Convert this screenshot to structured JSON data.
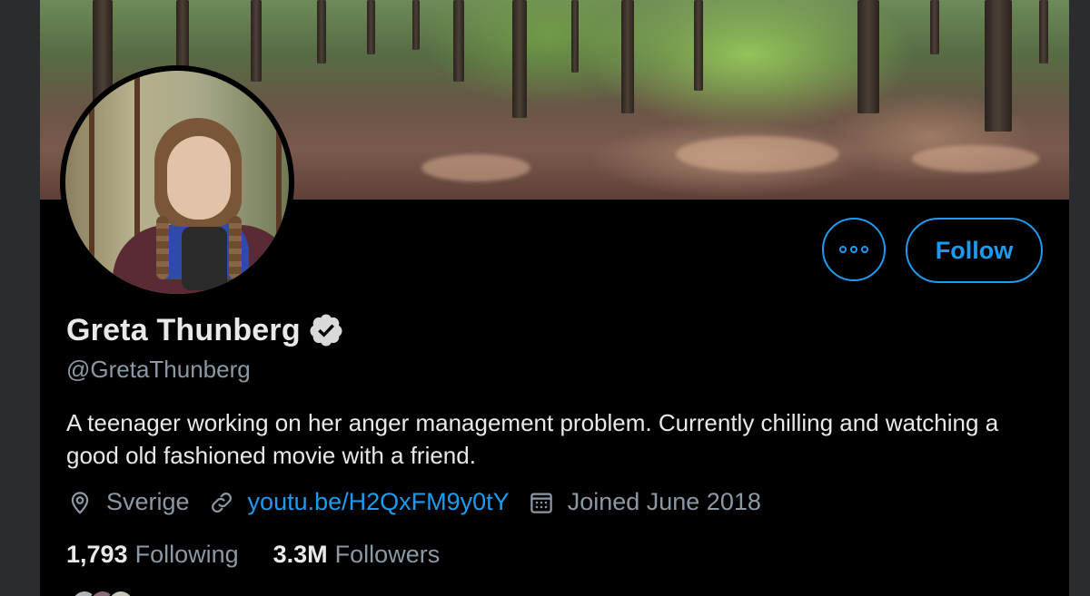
{
  "profile": {
    "display_name": "Greta Thunberg",
    "verified": true,
    "handle": "@GretaThunberg",
    "bio": "A teenager working on her anger management problem. Currently chilling and watching a good old fashioned movie with a friend.",
    "location": "Sverige",
    "website": "youtu.be/H2QxFM9y0tY",
    "joined": "Joined June 2018",
    "following_count": "1,793",
    "following_label": "Following",
    "followers_count": "3.3M",
    "followers_label": "Followers"
  },
  "actions": {
    "follow_label": "Follow",
    "more_icon": "more-options-icon"
  },
  "icons": {
    "location": "location-pin-icon",
    "link": "link-icon",
    "calendar": "calendar-icon",
    "verified": "verified-badge-icon"
  },
  "colors": {
    "background": "#000000",
    "accent": "#1d9bf0",
    "primary_text": "#e7e9ea",
    "secondary_text": "#8b98a5"
  }
}
